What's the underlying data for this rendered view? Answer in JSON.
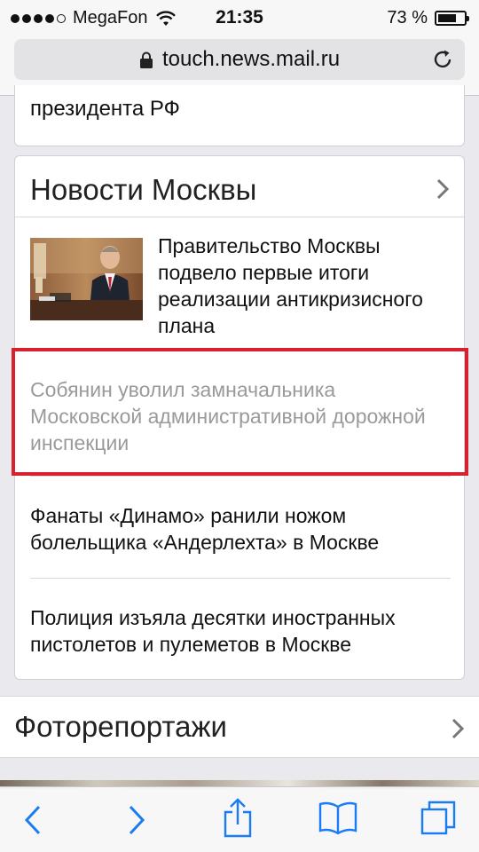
{
  "status_bar": {
    "carrier": "MegaFon",
    "time": "21:35",
    "battery_percent": "73 %",
    "battery_level": 0.73,
    "signal_bars": 4
  },
  "browser": {
    "url": "touch.news.mail.ru"
  },
  "content": {
    "previous_item_tail": "президента РФ",
    "moscow_news": {
      "title": "Новости Москвы",
      "items": [
        {
          "text": "Правительство Москвы подвело первые итоги реализации антикризисного плана",
          "state": "unvisited"
        },
        {
          "text": "Собянин уволил замначальника Московской административной дорожной инспекции",
          "state": "visited"
        },
        {
          "text": "Фанаты «Динамо» ранили ножом болельщика «Андерлехта» в Москве",
          "state": "unvisited"
        },
        {
          "text": "Полиция изъяла десятки иностранных пистолетов и пулеметов в Москве",
          "state": "unvisited"
        }
      ]
    },
    "photo_reports": {
      "title": "Фоторепортажи"
    }
  },
  "colors": {
    "highlight_border": "#d9202d",
    "accent_blue": "#1a7cf5",
    "visited_text": "#9a9a9a"
  },
  "icons": {
    "toolbar": [
      "back-icon",
      "forward-icon",
      "share-icon",
      "bookmarks-icon",
      "tabs-icon"
    ]
  }
}
